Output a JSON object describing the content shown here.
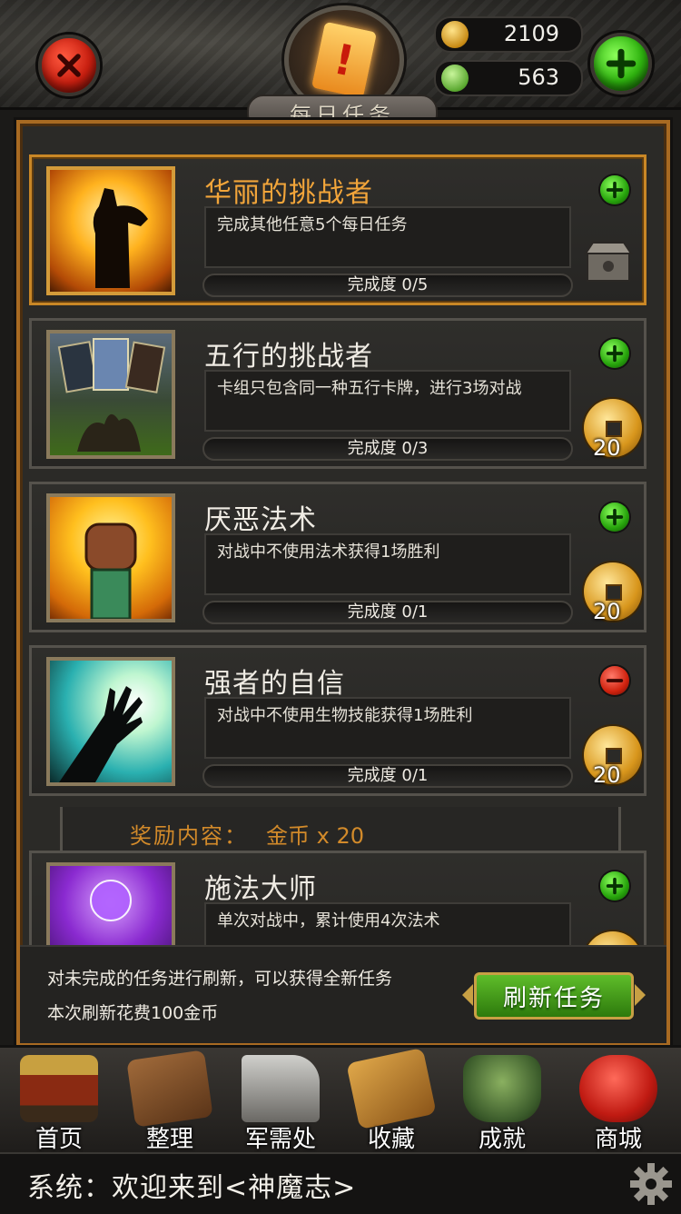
{
  "header": {
    "title": "每日任务",
    "coins": "2109",
    "gems": "563"
  },
  "quests": [
    {
      "title": "华丽的挑战者",
      "desc": "完成其他任意5个每日任务",
      "progress": "完成度 0/5",
      "toggle": "plus",
      "reward": "chest"
    },
    {
      "title": "五行的挑战者",
      "desc": "卡组只包含同一种五行卡牌，进行3场对战",
      "progress": "完成度 0/3",
      "toggle": "plus",
      "reward_amount": "20"
    },
    {
      "title": "厌恶法术",
      "desc": "对战中不使用法术获得1场胜利",
      "progress": "完成度 0/1",
      "toggle": "plus",
      "reward_amount": "20"
    },
    {
      "title": "强者的自信",
      "desc": "对战中不使用生物技能获得1场胜利",
      "progress": "完成度 0/1",
      "toggle": "minus",
      "reward_amount": "20"
    },
    {
      "title": "施法大师",
      "desc": "单次对战中，累计使用4次法术",
      "toggle": "plus"
    }
  ],
  "reward_detail": {
    "label": "奖励内容：",
    "value": "金币 x 20"
  },
  "refresh": {
    "line1": "对未完成的任务进行刷新，可以获得全新任务",
    "line2": "本次刷新花费100金币",
    "button": "刷新任务"
  },
  "nav": [
    {
      "label": "首页",
      "icon": "pagoda-icon"
    },
    {
      "label": "整理",
      "icon": "book-icon"
    },
    {
      "label": "军需处",
      "icon": "anvil-icon"
    },
    {
      "label": "收藏",
      "icon": "scroll-case-icon"
    },
    {
      "label": "成就",
      "icon": "bronze-cauldron-icon"
    },
    {
      "label": "商城",
      "icon": "treasure-bag-icon"
    }
  ],
  "chat": {
    "message": "系统：欢迎来到<神魔志>"
  },
  "colors": {
    "accent_gold": "#d28a2a",
    "active_title": "#f2a53a",
    "frame": "#a86a22",
    "plus_green": "#27a40c",
    "minus_red": "#d0220e"
  }
}
